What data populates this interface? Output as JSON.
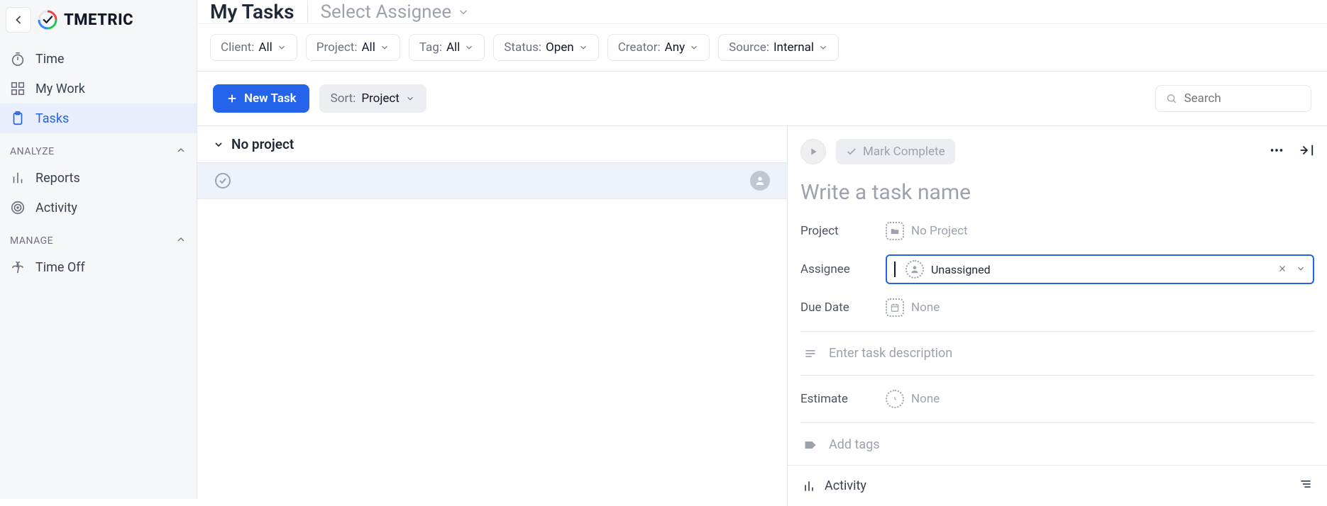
{
  "brand": {
    "name": "TMETRIC"
  },
  "sidebar": {
    "items": [
      {
        "label": "Time"
      },
      {
        "label": "My Work"
      },
      {
        "label": "Tasks"
      }
    ],
    "section_analyze": "ANALYZE",
    "items_analyze": [
      {
        "label": "Reports"
      },
      {
        "label": "Activity"
      }
    ],
    "section_manage": "MANAGE",
    "items_manage": [
      {
        "label": "Time Off"
      }
    ]
  },
  "header": {
    "page_title": "My Tasks",
    "assignee_placeholder": "Select Assignee"
  },
  "filters": {
    "client": {
      "label": "Client:",
      "value": "All"
    },
    "project": {
      "label": "Project:",
      "value": "All"
    },
    "tag": {
      "label": "Tag:",
      "value": "All"
    },
    "status": {
      "label": "Status:",
      "value": "Open"
    },
    "creator": {
      "label": "Creator:",
      "value": "Any"
    },
    "source": {
      "label": "Source:",
      "value": "Internal"
    }
  },
  "toolbar": {
    "new_task": "New Task",
    "sort_label": "Sort:",
    "sort_value": "Project",
    "search_placeholder": "Search"
  },
  "task_list": {
    "group": "No project"
  },
  "detail": {
    "mark_complete": "Mark Complete",
    "title_placeholder": "Write a task name",
    "project_label": "Project",
    "project_value": "No Project",
    "assignee_label": "Assignee",
    "assignee_value": "Unassigned",
    "due_label": "Due Date",
    "due_value": "None",
    "description_placeholder": "Enter task description",
    "estimate_label": "Estimate",
    "estimate_value": "None",
    "add_tags": "Add tags",
    "activity_label": "Activity"
  }
}
